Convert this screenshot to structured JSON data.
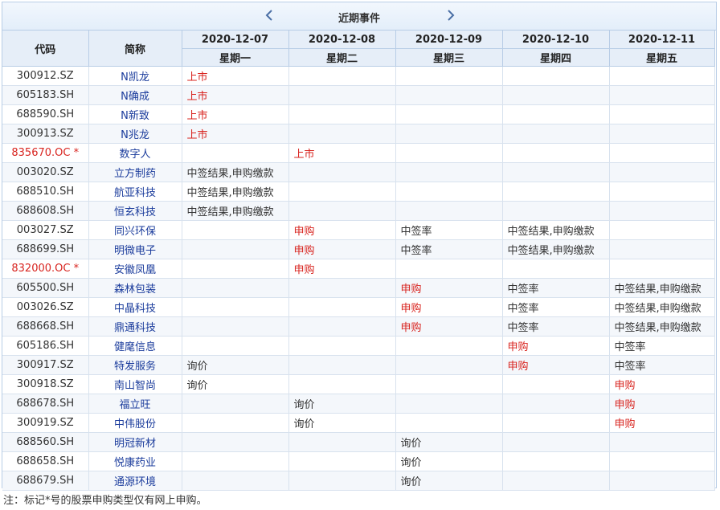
{
  "header": {
    "title": "近期事件",
    "col_code": "代码",
    "col_name": "简称",
    "dates": [
      {
        "date": "2020-12-07",
        "weekday": "星期一"
      },
      {
        "date": "2020-12-08",
        "weekday": "星期二"
      },
      {
        "date": "2020-12-09",
        "weekday": "星期三"
      },
      {
        "date": "2020-12-10",
        "weekday": "星期四"
      },
      {
        "date": "2020-12-11",
        "weekday": "星期五"
      }
    ]
  },
  "rows": [
    {
      "code": "300912.SZ",
      "name": "N凯龙",
      "star": false,
      "events": [
        {
          "t": "上市",
          "hl": true
        },
        {
          "t": "",
          "hl": false
        },
        {
          "t": "",
          "hl": false
        },
        {
          "t": "",
          "hl": false
        },
        {
          "t": "",
          "hl": false
        }
      ]
    },
    {
      "code": "605183.SH",
      "name": "N确成",
      "star": false,
      "events": [
        {
          "t": "上市",
          "hl": true
        },
        {
          "t": "",
          "hl": false
        },
        {
          "t": "",
          "hl": false
        },
        {
          "t": "",
          "hl": false
        },
        {
          "t": "",
          "hl": false
        }
      ]
    },
    {
      "code": "688590.SH",
      "name": "N新致",
      "star": false,
      "events": [
        {
          "t": "上市",
          "hl": true
        },
        {
          "t": "",
          "hl": false
        },
        {
          "t": "",
          "hl": false
        },
        {
          "t": "",
          "hl": false
        },
        {
          "t": "",
          "hl": false
        }
      ]
    },
    {
      "code": "300913.SZ",
      "name": "N兆龙",
      "star": false,
      "events": [
        {
          "t": "上市",
          "hl": true
        },
        {
          "t": "",
          "hl": false
        },
        {
          "t": "",
          "hl": false
        },
        {
          "t": "",
          "hl": false
        },
        {
          "t": "",
          "hl": false
        }
      ]
    },
    {
      "code": "835670.OC *",
      "name": "数字人",
      "star": true,
      "events": [
        {
          "t": "",
          "hl": false
        },
        {
          "t": "上市",
          "hl": true
        },
        {
          "t": "",
          "hl": false
        },
        {
          "t": "",
          "hl": false
        },
        {
          "t": "",
          "hl": false
        }
      ]
    },
    {
      "code": "003020.SZ",
      "name": "立方制药",
      "star": false,
      "events": [
        {
          "t": "中签结果,申购缴款",
          "hl": false
        },
        {
          "t": "",
          "hl": false
        },
        {
          "t": "",
          "hl": false
        },
        {
          "t": "",
          "hl": false
        },
        {
          "t": "",
          "hl": false
        }
      ]
    },
    {
      "code": "688510.SH",
      "name": "航亚科技",
      "star": false,
      "events": [
        {
          "t": "中签结果,申购缴款",
          "hl": false
        },
        {
          "t": "",
          "hl": false
        },
        {
          "t": "",
          "hl": false
        },
        {
          "t": "",
          "hl": false
        },
        {
          "t": "",
          "hl": false
        }
      ]
    },
    {
      "code": "688608.SH",
      "name": "恒玄科技",
      "star": false,
      "events": [
        {
          "t": "中签结果,申购缴款",
          "hl": false
        },
        {
          "t": "",
          "hl": false
        },
        {
          "t": "",
          "hl": false
        },
        {
          "t": "",
          "hl": false
        },
        {
          "t": "",
          "hl": false
        }
      ]
    },
    {
      "code": "003027.SZ",
      "name": "同兴环保",
      "star": false,
      "events": [
        {
          "t": "",
          "hl": false
        },
        {
          "t": "申购",
          "hl": true
        },
        {
          "t": "中签率",
          "hl": false
        },
        {
          "t": "中签结果,申购缴款",
          "hl": false
        },
        {
          "t": "",
          "hl": false
        }
      ]
    },
    {
      "code": "688699.SH",
      "name": "明微电子",
      "star": false,
      "events": [
        {
          "t": "",
          "hl": false
        },
        {
          "t": "申购",
          "hl": true
        },
        {
          "t": "中签率",
          "hl": false
        },
        {
          "t": "中签结果,申购缴款",
          "hl": false
        },
        {
          "t": "",
          "hl": false
        }
      ]
    },
    {
      "code": "832000.OC *",
      "name": "安徽凤凰",
      "star": true,
      "events": [
        {
          "t": "",
          "hl": false
        },
        {
          "t": "申购",
          "hl": true
        },
        {
          "t": "",
          "hl": false
        },
        {
          "t": "",
          "hl": false
        },
        {
          "t": "",
          "hl": false
        }
      ]
    },
    {
      "code": "605500.SH",
      "name": "森林包装",
      "star": false,
      "events": [
        {
          "t": "",
          "hl": false
        },
        {
          "t": "",
          "hl": false
        },
        {
          "t": "申购",
          "hl": true
        },
        {
          "t": "中签率",
          "hl": false
        },
        {
          "t": "中签结果,申购缴款",
          "hl": false
        }
      ]
    },
    {
      "code": "003026.SZ",
      "name": "中晶科技",
      "star": false,
      "events": [
        {
          "t": "",
          "hl": false
        },
        {
          "t": "",
          "hl": false
        },
        {
          "t": "申购",
          "hl": true
        },
        {
          "t": "中签率",
          "hl": false
        },
        {
          "t": "中签结果,申购缴款",
          "hl": false
        }
      ]
    },
    {
      "code": "688668.SH",
      "name": "鼎通科技",
      "star": false,
      "events": [
        {
          "t": "",
          "hl": false
        },
        {
          "t": "",
          "hl": false
        },
        {
          "t": "申购",
          "hl": true
        },
        {
          "t": "中签率",
          "hl": false
        },
        {
          "t": "中签结果,申购缴款",
          "hl": false
        }
      ]
    },
    {
      "code": "605186.SH",
      "name": "健麾信息",
      "star": false,
      "events": [
        {
          "t": "",
          "hl": false
        },
        {
          "t": "",
          "hl": false
        },
        {
          "t": "",
          "hl": false
        },
        {
          "t": "申购",
          "hl": true
        },
        {
          "t": "中签率",
          "hl": false
        }
      ]
    },
    {
      "code": "300917.SZ",
      "name": "特发服务",
      "star": false,
      "events": [
        {
          "t": "询价",
          "hl": false
        },
        {
          "t": "",
          "hl": false
        },
        {
          "t": "",
          "hl": false
        },
        {
          "t": "申购",
          "hl": true
        },
        {
          "t": "中签率",
          "hl": false
        }
      ]
    },
    {
      "code": "300918.SZ",
      "name": "南山智尚",
      "star": false,
      "events": [
        {
          "t": "询价",
          "hl": false
        },
        {
          "t": "",
          "hl": false
        },
        {
          "t": "",
          "hl": false
        },
        {
          "t": "",
          "hl": false
        },
        {
          "t": "申购",
          "hl": true
        }
      ]
    },
    {
      "code": "688678.SH",
      "name": "福立旺",
      "star": false,
      "events": [
        {
          "t": "",
          "hl": false
        },
        {
          "t": "询价",
          "hl": false
        },
        {
          "t": "",
          "hl": false
        },
        {
          "t": "",
          "hl": false
        },
        {
          "t": "申购",
          "hl": true
        }
      ]
    },
    {
      "code": "300919.SZ",
      "name": "中伟股份",
      "star": false,
      "events": [
        {
          "t": "",
          "hl": false
        },
        {
          "t": "询价",
          "hl": false
        },
        {
          "t": "",
          "hl": false
        },
        {
          "t": "",
          "hl": false
        },
        {
          "t": "申购",
          "hl": true
        }
      ]
    },
    {
      "code": "688560.SH",
      "name": "明冠新材",
      "star": false,
      "events": [
        {
          "t": "",
          "hl": false
        },
        {
          "t": "",
          "hl": false
        },
        {
          "t": "询价",
          "hl": false
        },
        {
          "t": "",
          "hl": false
        },
        {
          "t": "",
          "hl": false
        }
      ]
    },
    {
      "code": "688658.SH",
      "name": "悦康药业",
      "star": false,
      "events": [
        {
          "t": "",
          "hl": false
        },
        {
          "t": "",
          "hl": false
        },
        {
          "t": "询价",
          "hl": false
        },
        {
          "t": "",
          "hl": false
        },
        {
          "t": "",
          "hl": false
        }
      ]
    },
    {
      "code": "688679.SH",
      "name": "通源环境",
      "star": false,
      "events": [
        {
          "t": "",
          "hl": false
        },
        {
          "t": "",
          "hl": false
        },
        {
          "t": "询价",
          "hl": false
        },
        {
          "t": "",
          "hl": false
        },
        {
          "t": "",
          "hl": false
        }
      ]
    }
  ],
  "note": "注：标记*号的股票申购类型仅有网上申购。",
  "icons": {
    "prev": "chevron-left-icon",
    "next": "chevron-right-icon"
  },
  "colors": {
    "highlight": "#d8231e",
    "name_link": "#1b3c9c",
    "header_bg": "#e6eef8"
  }
}
